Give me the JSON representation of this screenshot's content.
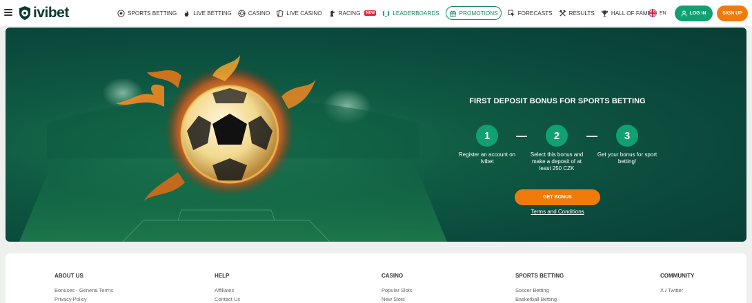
{
  "header": {
    "logo_text": "ivibet",
    "nav": [
      {
        "label": "SPORTS BETTING",
        "icon": "soccer-ball-icon"
      },
      {
        "label": "LIVE BETTING",
        "icon": "flame-icon"
      },
      {
        "label": "CASINO",
        "icon": "casino-chip-icon"
      },
      {
        "label": "LIVE CASINO",
        "icon": "cards-icon"
      },
      {
        "label": "RACING",
        "icon": "horse-icon",
        "badge": "NEW"
      },
      {
        "label": "LEADERBOARDS",
        "icon": "laurel-icon"
      },
      {
        "label": "PROMOTIONS",
        "icon": "gift-icon"
      },
      {
        "label": "FORECASTS",
        "icon": "cursor-icon"
      },
      {
        "label": "RESULTS",
        "icon": "crossed-hammers-icon"
      },
      {
        "label": "HALL OF FAME",
        "icon": "trophy-icon"
      }
    ],
    "language": "EN",
    "login_label": "LOG IN",
    "signup_label": "SIGN UP"
  },
  "banner": {
    "title": "FIRST DEPOSIT BONUS FOR SPORTS BETTING",
    "steps": [
      {
        "number": "1",
        "text": "Register an account on Ivibet"
      },
      {
        "number": "2",
        "text": "Select this bonus and make a deposit of at least 250 CZK"
      },
      {
        "number": "3",
        "text": "Get your bonus for sport betting!"
      }
    ],
    "cta_label": "GET BONUS",
    "terms_label": "Terms and Conditions"
  },
  "footer": {
    "columns": [
      {
        "heading": "ABOUT US",
        "links": [
          "Bonuses - General Terms",
          "Privacy Policy"
        ]
      },
      {
        "heading": "HELP",
        "links": [
          "Affiliates",
          "Contact Us"
        ]
      },
      {
        "heading": "CASINO",
        "links": [
          "Popular Slots",
          "New Slots"
        ]
      },
      {
        "heading": "SPORTS BETTING",
        "links": [
          "Soccer Betting",
          "Basketball Betting"
        ]
      },
      {
        "heading": "COMMUNITY",
        "links": [
          "X / Twitter"
        ]
      }
    ]
  },
  "colors": {
    "brand_green": "#10a072",
    "dark_green": "#0b4a3d",
    "accent_orange": "#f07b0c",
    "new_badge_red": "#e2283c"
  }
}
